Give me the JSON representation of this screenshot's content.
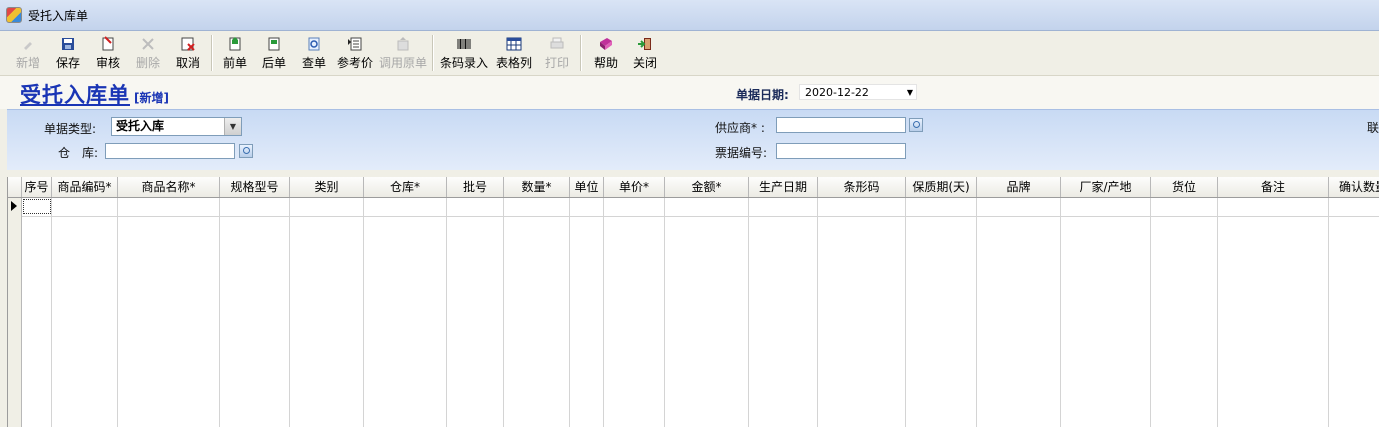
{
  "window": {
    "title": "受托入库单"
  },
  "toolbar": {
    "buttons": [
      {
        "label": "新增",
        "icon": "new-icon",
        "enabled": false
      },
      {
        "label": "保存",
        "icon": "save-icon",
        "enabled": true
      },
      {
        "label": "审核",
        "icon": "audit-icon",
        "enabled": true
      },
      {
        "label": "删除",
        "icon": "delete-icon",
        "enabled": false
      },
      {
        "label": "取消",
        "icon": "cancel-icon",
        "enabled": true
      },
      {
        "label": "前单",
        "icon": "prev-icon",
        "enabled": true
      },
      {
        "label": "后单",
        "icon": "next-icon",
        "enabled": true
      },
      {
        "label": "查单",
        "icon": "search-icon",
        "enabled": true
      },
      {
        "label": "参考价",
        "icon": "reference-price-icon",
        "enabled": true
      },
      {
        "label": "调用原单",
        "icon": "load-original-icon",
        "enabled": false
      },
      {
        "label": "条码录入",
        "icon": "barcode-icon",
        "enabled": true
      },
      {
        "label": "表格列",
        "icon": "table-columns-icon",
        "enabled": true
      },
      {
        "label": "打印",
        "icon": "print-icon",
        "enabled": false
      },
      {
        "label": "帮助",
        "icon": "help-icon",
        "enabled": true
      },
      {
        "label": "关闭",
        "icon": "close-icon",
        "enabled": true
      }
    ]
  },
  "header": {
    "title": "受托入库单",
    "mode_tag": "[新增]",
    "date_label": "单据日期:",
    "date_value": "2020-12-22"
  },
  "form": {
    "doc_type_label": "单据类型:",
    "doc_type_value": "受托入库",
    "warehouse_label": "仓　库:",
    "warehouse_value": "",
    "supplier_label": "供应商* :",
    "supplier_value": "",
    "invoice_no_label": "票据编号:",
    "invoice_no_value": "",
    "contact_label_partial": "联"
  },
  "grid": {
    "columns": [
      "序号",
      "商品编码*",
      "商品名称*",
      "规格型号",
      "类别",
      "仓库*",
      "批号",
      "数量*",
      "单位",
      "单价*",
      "金额*",
      "生产日期",
      "条形码",
      "保质期(天)",
      "品牌",
      "厂家/产地",
      "货位",
      "备注",
      "确认数量"
    ]
  },
  "colors": {
    "title_blue": "#1a35b5",
    "form_band": "#c8daf4",
    "toolbar_bg": "#f0efe6"
  }
}
